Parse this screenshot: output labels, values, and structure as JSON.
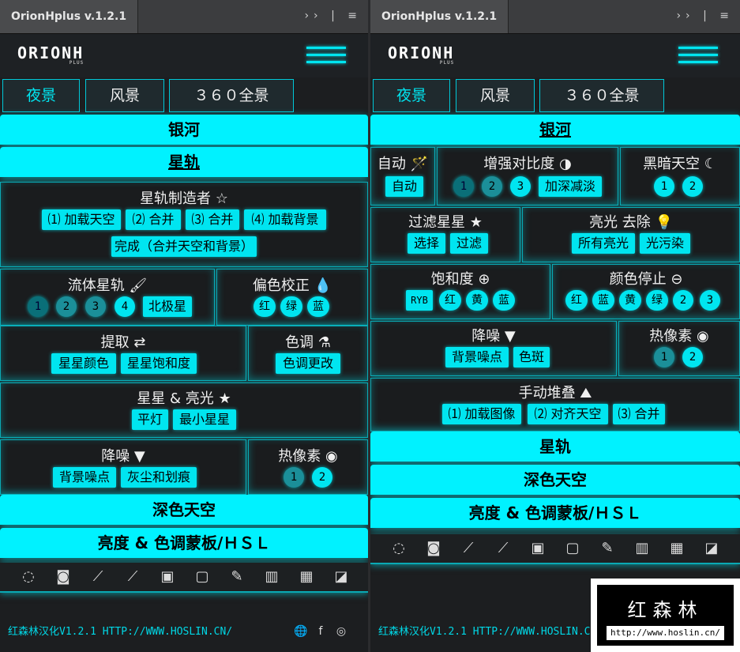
{
  "app_title": "OrionHplus v.1.2.1",
  "logo_text": "ORIONH",
  "logo_sub": "PLUS",
  "modes": [
    "夜景",
    "风景",
    "３６０全景"
  ],
  "left": {
    "bar_galaxy": "银河",
    "bar_startrails": "星轨",
    "startrail_maker": {
      "title": "星轨制造者 ☆",
      "buttons": [
        "⑴ 加载天空",
        "⑵ 合并",
        "⑶ 合并",
        "⑷ 加载背景"
      ],
      "finish": "完成（合并天空和背景）"
    },
    "fluid": {
      "title": "流体星轨 🖌",
      "nums": [
        "1",
        "2",
        "3",
        "4"
      ],
      "polaris": "北极星"
    },
    "colorfix": {
      "title": "偏色校正 💧",
      "buttons": [
        "红",
        "绿",
        "蓝"
      ]
    },
    "extract": {
      "title": "提取 ⇄",
      "buttons": [
        "星星颜色",
        "星星饱和度"
      ]
    },
    "tone": {
      "title": "色调 ⚗",
      "buttons": [
        "色调更改"
      ]
    },
    "starglow": {
      "title": "星星 & 亮光 ★",
      "buttons": [
        "平灯",
        "最小星星"
      ]
    },
    "denoise": {
      "title": "降噪 ▼",
      "buttons": [
        "背景噪点",
        "灰尘和划痕"
      ]
    },
    "hotpixel": {
      "title": "热像素 ◉",
      "nums": [
        "1",
        "2"
      ]
    },
    "bar_darksky": "深色天空",
    "bar_hsl": "亮度 & 色调蒙板/ＨＳＬ"
  },
  "right": {
    "bar_galaxy": "银河",
    "auto": {
      "title": "自动 🪄",
      "button": "自动"
    },
    "contrast": {
      "title": "增强对比度 ◑",
      "nums": [
        "1",
        "2",
        "3"
      ],
      "deepen": "加深减淡"
    },
    "darksky": {
      "title": "黑暗天空 ☾",
      "nums": [
        "1",
        "2"
      ]
    },
    "filterstars": {
      "title": "过滤星星 ★",
      "buttons": [
        "选择",
        "过滤"
      ]
    },
    "lightremove": {
      "title": "亮光 去除 💡",
      "buttons": [
        "所有亮光",
        "光污染"
      ]
    },
    "saturation": {
      "title": "饱和度 ⊕",
      "buttons": [
        "RYB",
        "红",
        "黄",
        "蓝"
      ]
    },
    "colorstop": {
      "title": "颜色停止 ⊖",
      "buttons": [
        "红",
        "蓝",
        "黄",
        "绿",
        "2",
        "3"
      ]
    },
    "denoise": {
      "title": "降噪 ▼",
      "buttons": [
        "背景噪点",
        "色斑"
      ]
    },
    "hotpixel": {
      "title": "热像素 ◉",
      "nums": [
        "1",
        "2"
      ]
    },
    "stack": {
      "title": "手动堆叠 ⛰",
      "buttons": [
        "⑴ 加载图像",
        "⑵ 对齐天空",
        "⑶ 合并"
      ]
    },
    "bar_startrails": "星轨",
    "bar_darksky": "深色天空",
    "bar_hsl": "亮度 & 色调蒙板/ＨＳＬ"
  },
  "tools": [
    "lasso-brush-icon",
    "circle-mask-icon",
    "brush-dark-icon",
    "brush-light-icon",
    "gradient-dark-icon",
    "gradient-light-icon",
    "eyedropper-icon",
    "histogram-icon",
    "grid-icon",
    "exposure-icon"
  ],
  "tool_glyphs": [
    "◌",
    "◙",
    "⟋",
    "⟋",
    "▣",
    "▢",
    "✎",
    "▥",
    "▦",
    "◪"
  ],
  "footer": "红森林汉化V1.2.1 HTTP://WWW.HOSLIN.CN/",
  "social": [
    "🌐",
    "f",
    "◎"
  ],
  "watermark": {
    "title": "红森林",
    "url": "http://www.hoslin.cn/"
  },
  "colors": {
    "accent": "#00e5f0",
    "panel": "#1c1e20"
  }
}
